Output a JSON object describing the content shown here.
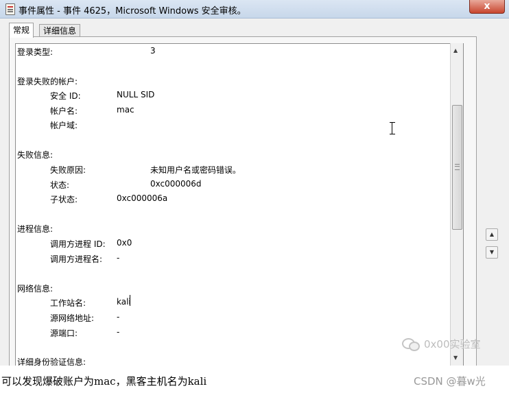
{
  "window": {
    "title": "事件属性 - 事件 4625，Microsoft Windows 安全审核。",
    "close_label": "x"
  },
  "tabs": [
    {
      "label": "常规"
    },
    {
      "label": "详细信息"
    }
  ],
  "rows": [
    {
      "label": "登录类型:",
      "value": "3"
    },
    {
      "label": "登录失败的帐户:"
    },
    {
      "label": "安全 ID:",
      "value": "NULL SID"
    },
    {
      "label": "帐户名:",
      "value": "mac"
    },
    {
      "label": "帐户域:"
    },
    {
      "label": "失败信息:"
    },
    {
      "label": "失败原因:",
      "value": "未知用户名或密码错误。"
    },
    {
      "label": "状态:",
      "value": "0xc000006d"
    },
    {
      "label": "子状态:",
      "value": "0xc000006a"
    },
    {
      "label": "进程信息:"
    },
    {
      "label": "调用方进程 ID:",
      "value": "0x0"
    },
    {
      "label": "调用方进程名:",
      "value": "-"
    },
    {
      "label": "网络信息:"
    },
    {
      "label": "工作站名:",
      "value": "kali"
    },
    {
      "label": "源网络地址:",
      "value": "-"
    },
    {
      "label": "源端口:",
      "value": "-"
    },
    {
      "label": "详细身份验证信息:"
    }
  ],
  "scroll": {
    "up": "▲",
    "down": "▼",
    "grip": "≡"
  },
  "side_buttons": {
    "up": "▲",
    "down": "▼"
  },
  "watermark": "0x00实验室",
  "caption": "可以发现爆破账户为mac，黑客主机名为kali",
  "csdn_credit": "CSDN @暮w光"
}
